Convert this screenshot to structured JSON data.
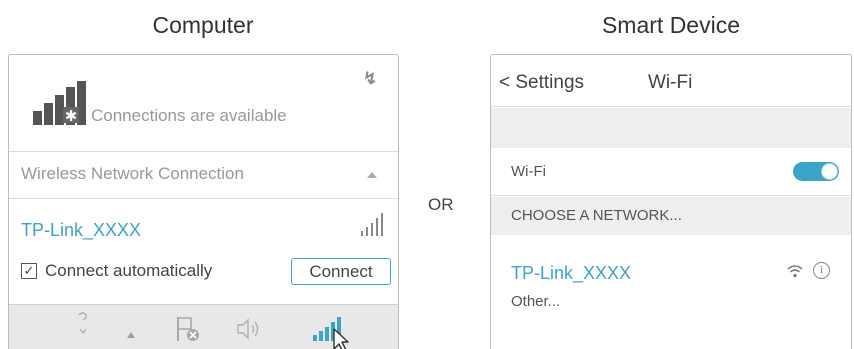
{
  "headings": {
    "computer": "Computer",
    "smart_device": "Smart Device"
  },
  "computer": {
    "availability_text": "Connections are available",
    "section_label": "Wireless Network Connection",
    "network_name": "TP-Link_XXXX",
    "auto_connect_label": "Connect automatically",
    "auto_connect_checked": true,
    "connect_button_label": "Connect",
    "taskbar_icons": [
      "pen-icon",
      "up-arrow-icon",
      "flag-icon",
      "speaker-icon",
      "network-icon"
    ]
  },
  "or_text": "OR",
  "smart_device": {
    "back_label": "< Settings",
    "title": "Wi-Fi",
    "wifi_label": "Wi-Fi",
    "wifi_enabled": true,
    "choose_label": "CHOOSE A NETWORK...",
    "network_name": "TP-Link_XXXX",
    "other_label": "Other..."
  },
  "colors": {
    "accent": "#3aa5c7",
    "panel_border": "#bdbdbd",
    "band": "#eeeeee",
    "taskbar": "#e8e8e8"
  }
}
